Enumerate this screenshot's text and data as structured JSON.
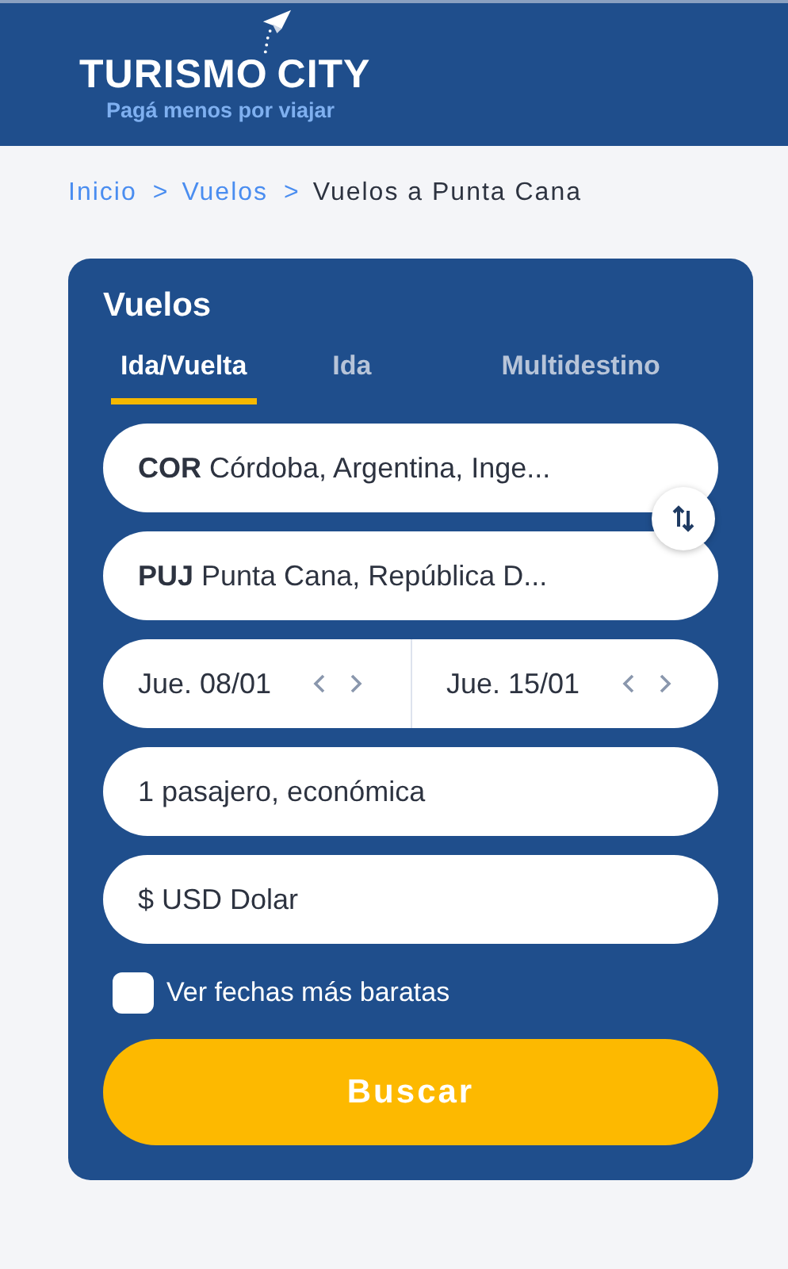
{
  "logo": {
    "left": "TURISMO",
    "right": "CITY",
    "tagline": "Pagá menos por viajar"
  },
  "breadcrumb": [
    {
      "label": "Inicio",
      "link": true,
      "separator": ">"
    },
    {
      "label": "Vuelos",
      "link": true,
      "separator": ">"
    },
    {
      "label": "Vuelos a Punta Cana",
      "link": false
    }
  ],
  "card": {
    "title": "Vuelos",
    "tabs": [
      {
        "label": "Ida/Vuelta",
        "selected": true
      },
      {
        "label": "Ida",
        "selected": false
      },
      {
        "label": "Multidestino",
        "selected": false
      }
    ],
    "origin": {
      "code": "COR",
      "value": "Córdoba, Argentina, Inge..."
    },
    "destination": {
      "code": "PUJ",
      "value": "Punta Cana, República D..."
    },
    "dates": [
      {
        "value": "Jue. 08/01"
      },
      {
        "value": "Jue. 15/01"
      }
    ],
    "passengers": "1 pasajero, económica",
    "currency": "$ USD Dolar",
    "cheap_dates": {
      "label": "Ver fechas más baratas",
      "checked": false
    },
    "search_button": "Buscar"
  }
}
